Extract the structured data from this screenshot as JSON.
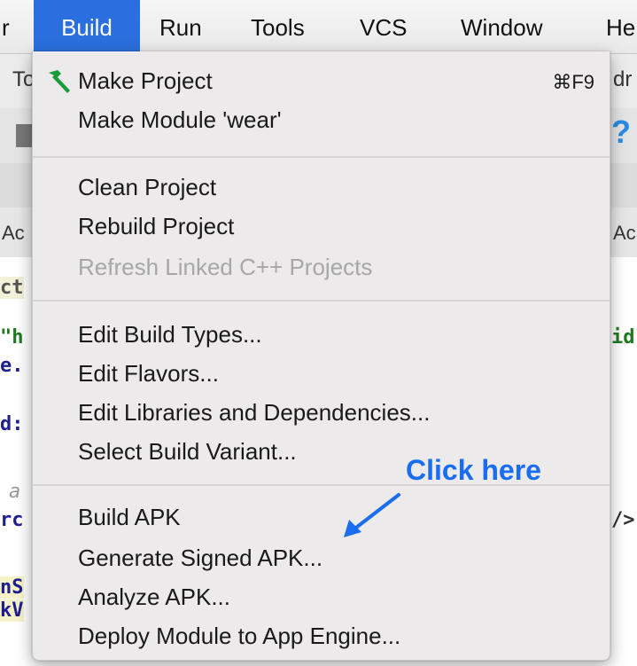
{
  "menubar": {
    "items": [
      "r",
      "Build",
      "Run",
      "Tools",
      "VCS",
      "Window",
      "He"
    ]
  },
  "background": {
    "toolbar_fragment_left": "To",
    "toolbar_fragment_right": "dr",
    "help_glyph": "?",
    "tab_left": "Ac",
    "tab_right": "Ac",
    "code_left": [
      "ct",
      "\"h",
      "e.",
      "d:",
      "a",
      "rc",
      "nS",
      "kV"
    ],
    "code_right": [
      "id",
      "/>"
    ]
  },
  "build_menu": {
    "groups": [
      [
        {
          "label": "Make Project",
          "icon": "hammer-icon",
          "shortcut": "⌘F9"
        },
        {
          "label": "Make Module 'wear'"
        }
      ],
      [
        {
          "label": "Clean Project"
        },
        {
          "label": "Rebuild Project"
        },
        {
          "label": "Refresh Linked C++ Projects",
          "disabled": true
        }
      ],
      [
        {
          "label": "Edit Build Types..."
        },
        {
          "label": "Edit Flavors..."
        },
        {
          "label": "Edit Libraries and Dependencies..."
        },
        {
          "label": "Select Build Variant..."
        }
      ],
      [
        {
          "label": "Build APK"
        },
        {
          "label": "Generate Signed APK..."
        },
        {
          "label": "Analyze APK..."
        },
        {
          "label": "Deploy Module to App Engine..."
        }
      ]
    ]
  },
  "annotation": {
    "text": "Click here",
    "color": "#1a6cf0"
  },
  "colors": {
    "menubar_active": "#2a6fdd",
    "menu_bg": "#eceaea",
    "disabled_text": "#a7a7a7"
  }
}
